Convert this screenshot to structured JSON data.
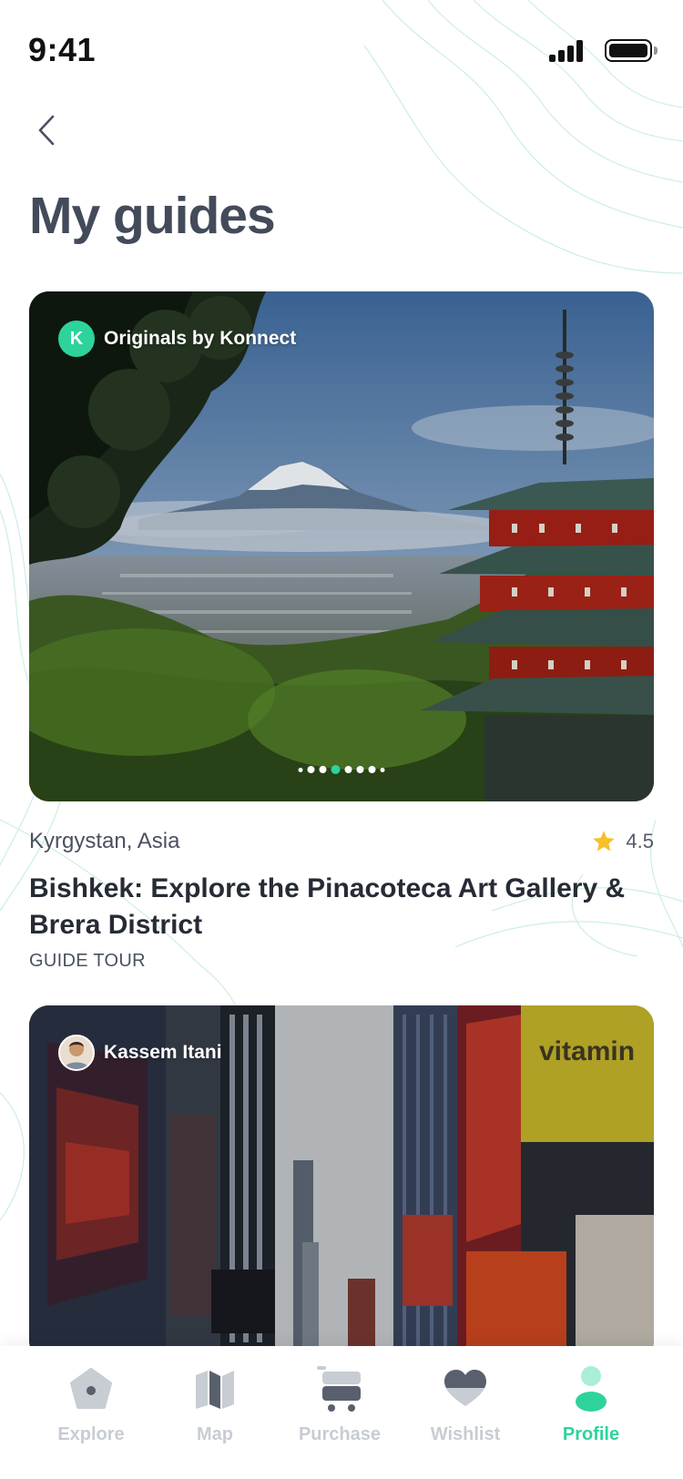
{
  "status_bar": {
    "time": "9:41"
  },
  "header": {
    "title": "My guides"
  },
  "guides": [
    {
      "author": "Originals by Konnect",
      "author_initial": "K",
      "location": "Kyrgystan, Asia",
      "rating": "4.5",
      "title": "Bishkek: Explore the Pinacoteca Art Gallery & Brera District",
      "category": "GUIDE TOUR",
      "carousel_active_index": 2,
      "carousel_count": 7
    },
    {
      "author": "Kassem Itani",
      "billboard_text": "vitamin"
    }
  ],
  "tab_bar": {
    "items": [
      {
        "label": "Explore",
        "icon": "explore-icon"
      },
      {
        "label": "Map",
        "icon": "map-icon"
      },
      {
        "label": "Purchase",
        "icon": "cart-icon"
      },
      {
        "label": "Wishlist",
        "icon": "heart-icon"
      },
      {
        "label": "Profile",
        "icon": "profile-icon",
        "active": true
      }
    ]
  },
  "colors": {
    "accent": "#2ed39c",
    "star": "#f6c02b",
    "title": "#434b5a",
    "inactive_tab": "#c8ccd3"
  }
}
